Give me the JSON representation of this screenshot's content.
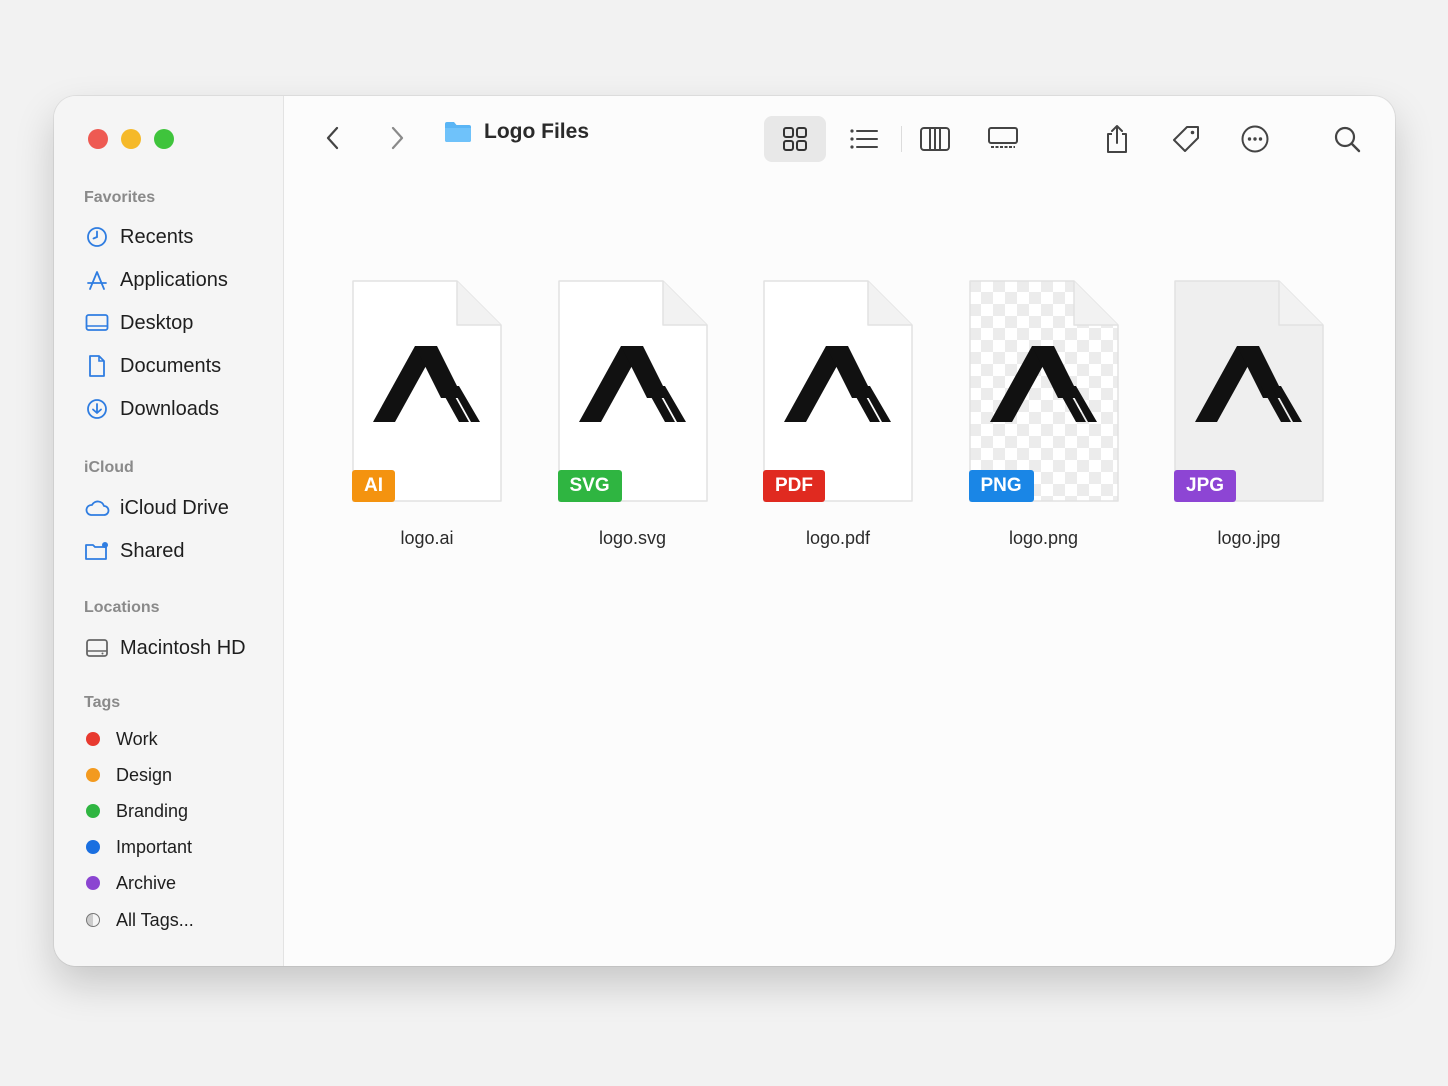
{
  "window": {
    "title": "Logo Files"
  },
  "sidebar": {
    "favorites_title": "Favorites",
    "favorites": [
      {
        "label": "Recents",
        "icon": "clock-icon"
      },
      {
        "label": "Applications",
        "icon": "applications-icon"
      },
      {
        "label": "Desktop",
        "icon": "desktop-icon"
      },
      {
        "label": "Documents",
        "icon": "document-icon"
      },
      {
        "label": "Downloads",
        "icon": "download-icon"
      }
    ],
    "icloud_title": "iCloud",
    "icloud": [
      {
        "label": "iCloud Drive",
        "icon": "cloud-icon"
      },
      {
        "label": "Shared",
        "icon": "shared-folder-icon"
      }
    ],
    "locations_title": "Locations",
    "locations": [
      {
        "label": "Macintosh HD",
        "icon": "hard-drive-icon"
      }
    ],
    "tags_title": "Tags",
    "tags": [
      {
        "label": "Work",
        "color": "#e8392f"
      },
      {
        "label": "Design",
        "color": "#f39a1f"
      },
      {
        "label": "Branding",
        "color": "#2fb541"
      },
      {
        "label": "Important",
        "color": "#1a6fe0"
      },
      {
        "label": "Archive",
        "color": "#8b45d1"
      },
      {
        "label": "All Tags...",
        "color": "none"
      }
    ]
  },
  "files": [
    {
      "name": "logo.ai",
      "badge": "AI",
      "badge_color": "#f4930f",
      "background": "plain"
    },
    {
      "name": "logo.svg",
      "badge": "SVG",
      "badge_color": "#2fb541",
      "background": "plain"
    },
    {
      "name": "logo.pdf",
      "badge": "PDF",
      "badge_color": "#e02a20",
      "background": "plain"
    },
    {
      "name": "logo.png",
      "badge": "PNG",
      "badge_color": "#1a86e6",
      "background": "checkerboard"
    },
    {
      "name": "logo.jpg",
      "badge": "JPG",
      "badge_color": "#8d45d4",
      "background": "light-gray"
    }
  ]
}
